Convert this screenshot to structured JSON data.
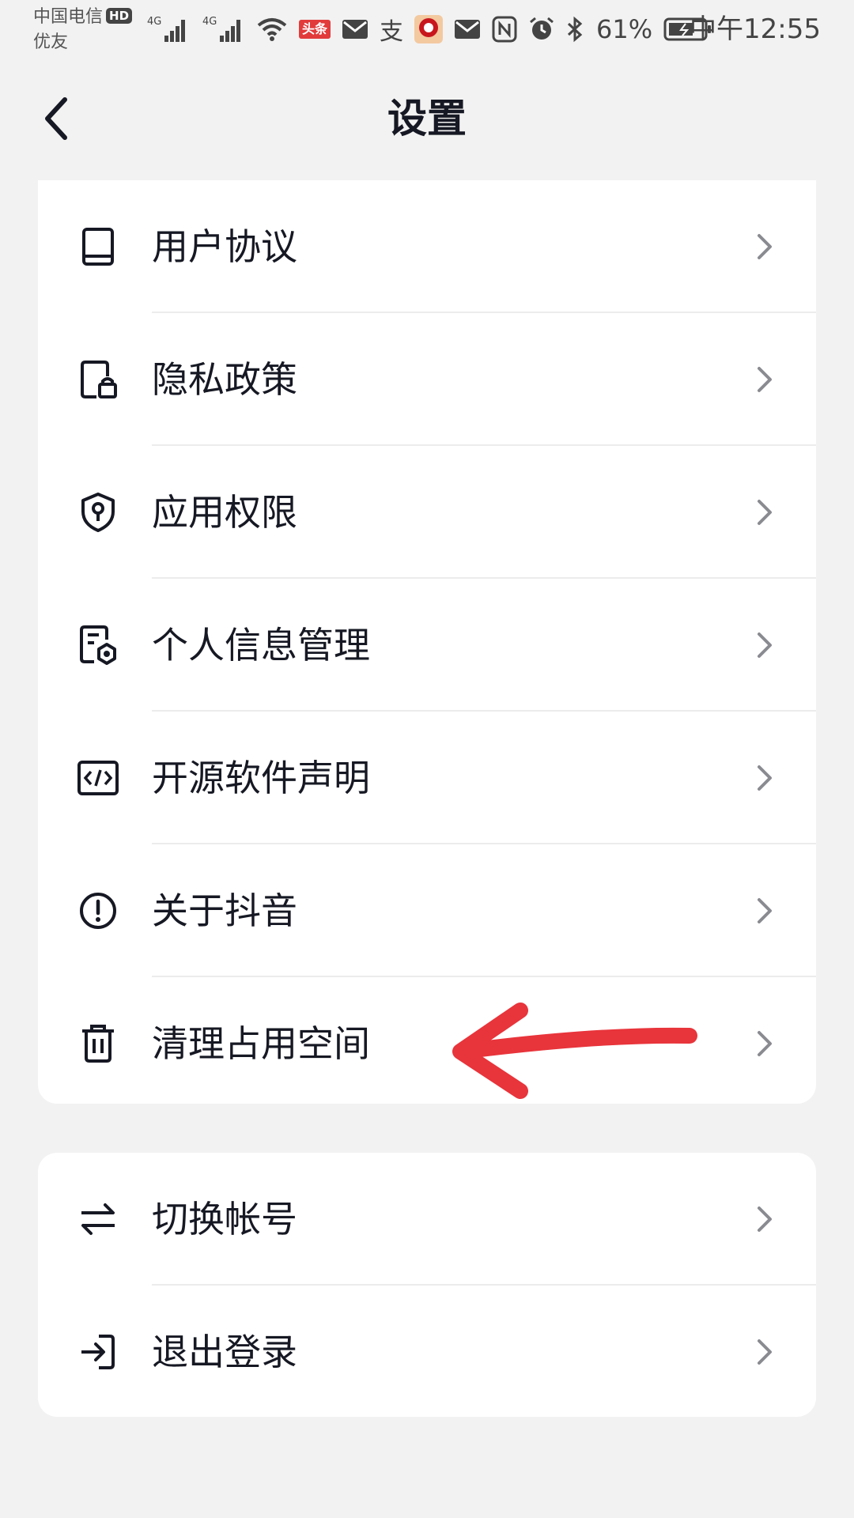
{
  "status_bar": {
    "carrier_line1": "中国电信",
    "hd": "HD",
    "carrier_line2": "优友",
    "net1": "4G",
    "net2": "4G",
    "toutiao_badge": "头条",
    "zhi_label": "支",
    "battery": "61%",
    "time": "中午12:55"
  },
  "header": {
    "title": "设置"
  },
  "groups": [
    {
      "items": [
        {
          "label": "用户协议",
          "icon": "book-icon"
        },
        {
          "label": "隐私政策",
          "icon": "document-lock-icon"
        },
        {
          "label": "应用权限",
          "icon": "shield-key-icon"
        },
        {
          "label": "个人信息管理",
          "icon": "document-settings-icon"
        },
        {
          "label": "开源软件声明",
          "icon": "code-icon"
        },
        {
          "label": "关于抖音",
          "icon": "info-circle-icon"
        },
        {
          "label": "清理占用空间",
          "icon": "trash-icon"
        }
      ]
    },
    {
      "items": [
        {
          "label": "切换帐号",
          "icon": "switch-arrows-icon"
        },
        {
          "label": "退出登录",
          "icon": "logout-icon"
        }
      ]
    }
  ],
  "colors": {
    "background": "#f2f2f2",
    "card": "#ffffff",
    "text": "#161823",
    "chevron": "#8a8b91",
    "divider": "#ececec",
    "annotation": "#e8343b"
  }
}
